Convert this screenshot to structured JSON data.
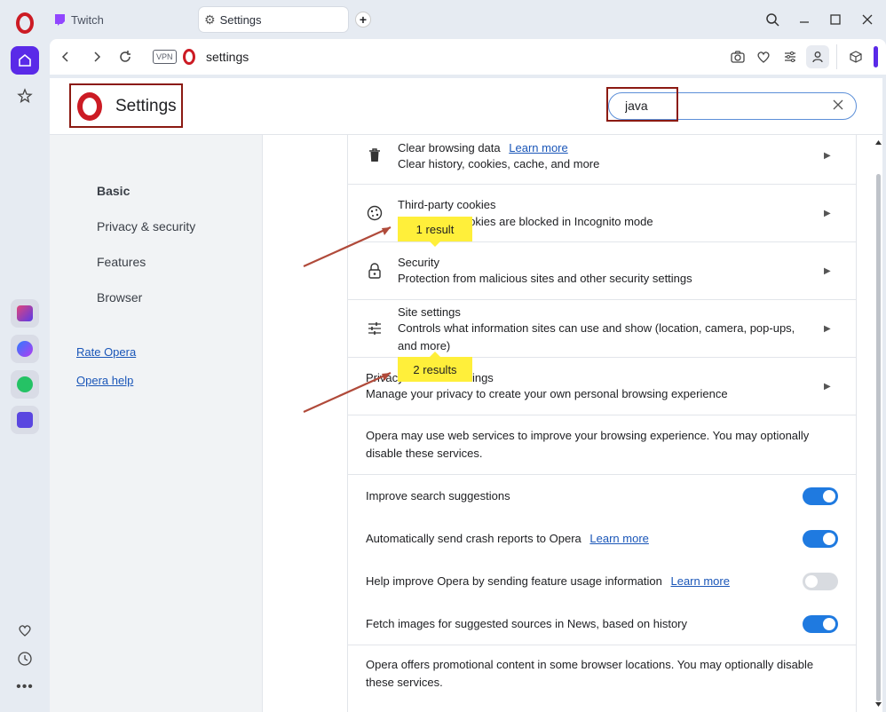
{
  "tabs": [
    {
      "label": "Twitch",
      "icon": "twitch-icon"
    },
    {
      "label": "Settings",
      "icon": "gear-icon"
    }
  ],
  "address": {
    "vpn_label": "VPN",
    "url": "settings"
  },
  "header": {
    "title": "Settings",
    "search_value": "java"
  },
  "sidebar": {
    "items": [
      {
        "label": "Basic"
      },
      {
        "label": "Privacy & security"
      },
      {
        "label": "Features"
      },
      {
        "label": "Browser"
      }
    ],
    "links": [
      {
        "label": "Rate Opera"
      },
      {
        "label": "Opera help"
      }
    ]
  },
  "content": {
    "clear_data": {
      "title": "Clear browsing data",
      "link": "Learn more",
      "sub": "Clear history, cookies, cache, and more"
    },
    "third_party": {
      "title": "Third-party cookies",
      "sub": "Third-party cookies are blocked in Incognito mode"
    },
    "security": {
      "title": "Security",
      "sub": "Protection from malicious sites and other security settings"
    },
    "site_settings": {
      "title": "Site settings",
      "sub": "Controls what information sites can use and show (location, camera, pop-ups, and more)"
    },
    "privacy_sandbox": {
      "title": "Privacy sandbox settings",
      "sub": "Manage your privacy to create your own personal browsing experience"
    },
    "web_services_note": "Opera may use web services to improve your browsing experience. You may optionally disable these services.",
    "toggles": [
      {
        "label": "Improve search suggestions",
        "link": "",
        "on": true
      },
      {
        "label": "Automatically send crash reports to Opera",
        "link": "Learn more",
        "on": true
      },
      {
        "label": "Help improve Opera by sending feature usage information",
        "link": "Learn more",
        "on": false
      },
      {
        "label": "Fetch images for suggested sources in News, based on history",
        "link": "",
        "on": true
      }
    ],
    "promo_note": "Opera offers promotional content in some browser locations. You may optionally disable these services."
  },
  "badges": {
    "first": "1 result",
    "second": "2 results"
  },
  "colors": {
    "accent": "#1f7ae0",
    "badge": "#ffef3a",
    "annotation": "#8b1a12",
    "opera_red": "#cc1b24"
  }
}
